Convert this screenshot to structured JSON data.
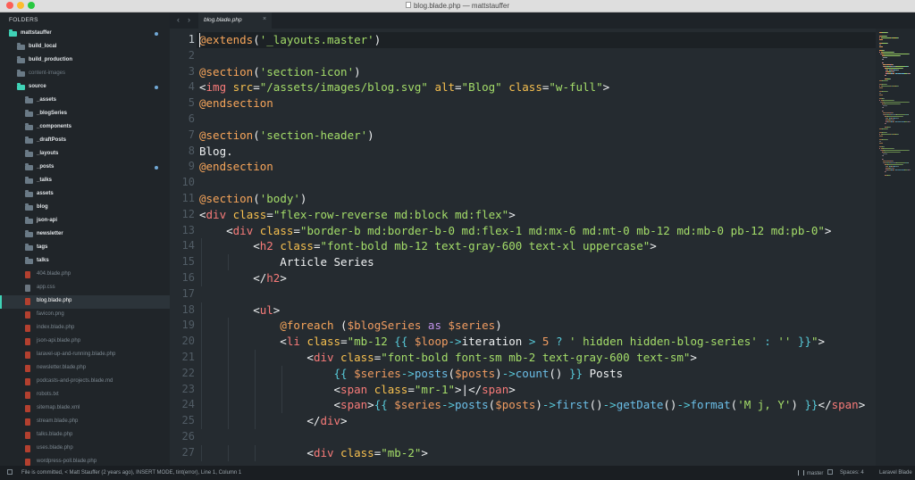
{
  "window": {
    "title": "blog.blade.php — mattstauffer"
  },
  "sidebar": {
    "header": "FOLDERS",
    "items": [
      {
        "label": "mattstauffer",
        "type": "folder-open",
        "depth": 0,
        "bold": true,
        "dot": true
      },
      {
        "label": "build_local",
        "type": "folder",
        "depth": 1,
        "bold": true
      },
      {
        "label": "build_production",
        "type": "folder",
        "depth": 1,
        "bold": true
      },
      {
        "label": "content-images",
        "type": "folder",
        "depth": 1,
        "dim": true
      },
      {
        "label": "source",
        "type": "folder-open",
        "depth": 1,
        "bold": true,
        "dot": true
      },
      {
        "label": "_assets",
        "type": "folder",
        "depth": 2,
        "bold": true
      },
      {
        "label": "_blogSeries",
        "type": "folder",
        "depth": 2,
        "bold": true
      },
      {
        "label": "_components",
        "type": "folder",
        "depth": 2,
        "bold": true
      },
      {
        "label": "_draftPosts",
        "type": "folder",
        "depth": 2,
        "bold": true
      },
      {
        "label": "_layouts",
        "type": "folder",
        "depth": 2,
        "bold": true
      },
      {
        "label": "_posts",
        "type": "folder",
        "depth": 2,
        "bold": true,
        "dot": true
      },
      {
        "label": "_talks",
        "type": "folder",
        "depth": 2,
        "bold": true
      },
      {
        "label": "assets",
        "type": "folder",
        "depth": 2,
        "bold": true
      },
      {
        "label": "blog",
        "type": "folder",
        "depth": 2,
        "bold": true
      },
      {
        "label": "json-api",
        "type": "folder",
        "depth": 2,
        "bold": true
      },
      {
        "label": "newsletter",
        "type": "folder",
        "depth": 2,
        "bold": true
      },
      {
        "label": "tags",
        "type": "folder",
        "depth": 2,
        "bold": true
      },
      {
        "label": "talks",
        "type": "folder",
        "depth": 2,
        "bold": true
      },
      {
        "label": "404.blade.php",
        "type": "file",
        "depth": 2
      },
      {
        "label": "app.css",
        "type": "file-gray",
        "depth": 2
      },
      {
        "label": "blog.blade.php",
        "type": "file",
        "depth": 2,
        "selected": true
      },
      {
        "label": "favicon.png",
        "type": "file",
        "depth": 2
      },
      {
        "label": "index.blade.php",
        "type": "file",
        "depth": 2
      },
      {
        "label": "json-api.blade.php",
        "type": "file",
        "depth": 2
      },
      {
        "label": "laravel-up-and-running.blade.php",
        "type": "file",
        "depth": 2
      },
      {
        "label": "newsletter.blade.php",
        "type": "file",
        "depth": 2
      },
      {
        "label": "podcasts-and-projects.blade.md",
        "type": "file",
        "depth": 2
      },
      {
        "label": "robots.txt",
        "type": "file",
        "depth": 2
      },
      {
        "label": "sitemap.blade.xml",
        "type": "file",
        "depth": 2
      },
      {
        "label": "stream.blade.php",
        "type": "file",
        "depth": 2
      },
      {
        "label": "talks.blade.php",
        "type": "file",
        "depth": 2
      },
      {
        "label": "uses.blade.php",
        "type": "file",
        "depth": 2
      },
      {
        "label": "wordpress-poll.blade.php",
        "type": "file",
        "depth": 2
      }
    ]
  },
  "tabs": {
    "back": "‹",
    "forward": "›",
    "items": [
      {
        "label": "blog.blade.php",
        "close": "×",
        "active": true
      }
    ]
  },
  "editor": {
    "active_line": 1,
    "lines": [
      [
        [
          "d",
          "@extends"
        ],
        [
          "tx",
          "("
        ],
        [
          "s",
          "'_layouts.master'"
        ],
        [
          "tx",
          ")"
        ]
      ],
      [],
      [
        [
          "d",
          "@section"
        ],
        [
          "tx",
          "("
        ],
        [
          "s",
          "'section-icon'"
        ],
        [
          "tx",
          ")"
        ]
      ],
      [
        [
          "tx",
          "<"
        ],
        [
          "t",
          "img"
        ],
        [
          "tx",
          " "
        ],
        [
          "a",
          "src"
        ],
        [
          "tx",
          "="
        ],
        [
          "s",
          "\"/assets/images/blog.svg\""
        ],
        [
          "tx",
          " "
        ],
        [
          "a",
          "alt"
        ],
        [
          "tx",
          "="
        ],
        [
          "s",
          "\"Blog\""
        ],
        [
          "tx",
          " "
        ],
        [
          "a",
          "class"
        ],
        [
          "tx",
          "="
        ],
        [
          "s",
          "\"w-full\""
        ],
        [
          "tx",
          ">"
        ]
      ],
      [
        [
          "d",
          "@endsection"
        ]
      ],
      [],
      [
        [
          "d",
          "@section"
        ],
        [
          "tx",
          "("
        ],
        [
          "s",
          "'section-header'"
        ],
        [
          "tx",
          ")"
        ]
      ],
      [
        [
          "tx",
          "Blog."
        ]
      ],
      [
        [
          "d",
          "@endsection"
        ]
      ],
      [],
      [
        [
          "d",
          "@section"
        ],
        [
          "tx",
          "("
        ],
        [
          "s",
          "'body'"
        ],
        [
          "tx",
          ")"
        ]
      ],
      [
        [
          "tx",
          "<"
        ],
        [
          "t",
          "div"
        ],
        [
          "tx",
          " "
        ],
        [
          "a",
          "class"
        ],
        [
          "tx",
          "="
        ],
        [
          "s",
          "\"flex-row-reverse md:block md:flex\""
        ],
        [
          "tx",
          ">"
        ]
      ],
      [
        [
          "tx",
          "    <"
        ],
        [
          "t",
          "div"
        ],
        [
          "tx",
          " "
        ],
        [
          "a",
          "class"
        ],
        [
          "tx",
          "="
        ],
        [
          "s",
          "\"border-b md:border-b-0 md:flex-1 md:mx-6 md:mt-0 mb-12 md:mb-0 pb-12 md:pb-0\""
        ],
        [
          "tx",
          ">"
        ]
      ],
      [
        [
          "tx",
          "        <"
        ],
        [
          "t",
          "h2"
        ],
        [
          "tx",
          " "
        ],
        [
          "a",
          "class"
        ],
        [
          "tx",
          "="
        ],
        [
          "s",
          "\"font-bold mb-12 text-gray-600 text-xl uppercase\""
        ],
        [
          "tx",
          ">"
        ]
      ],
      [
        [
          "tx",
          "            Article Series"
        ]
      ],
      [
        [
          "tx",
          "        </"
        ],
        [
          "t",
          "h2"
        ],
        [
          "tx",
          ">"
        ]
      ],
      [],
      [
        [
          "tx",
          "        <"
        ],
        [
          "t",
          "ul"
        ],
        [
          "tx",
          ">"
        ]
      ],
      [
        [
          "tx",
          "            "
        ],
        [
          "d",
          "@foreach"
        ],
        [
          "tx",
          " ("
        ],
        [
          "v",
          "$blogSeries"
        ],
        [
          "tx",
          " "
        ],
        [
          "k",
          "as"
        ],
        [
          "tx",
          " "
        ],
        [
          "v",
          "$series"
        ],
        [
          "tx",
          ")"
        ]
      ],
      [
        [
          "tx",
          "            <"
        ],
        [
          "t",
          "li"
        ],
        [
          "tx",
          " "
        ],
        [
          "a",
          "class"
        ],
        [
          "tx",
          "="
        ],
        [
          "s",
          "\"mb-12 "
        ],
        [
          "p",
          "{{ "
        ],
        [
          "v",
          "$loop"
        ],
        [
          "p",
          "->"
        ],
        [
          "tx",
          "iteration "
        ],
        [
          "p",
          ">"
        ],
        [
          "tx",
          " "
        ],
        [
          "n",
          "5"
        ],
        [
          "tx",
          " "
        ],
        [
          "p",
          "?"
        ],
        [
          "tx",
          " "
        ],
        [
          "s",
          "' hidden hidden-blog-series'"
        ],
        [
          "tx",
          " "
        ],
        [
          "p",
          ":"
        ],
        [
          "tx",
          " "
        ],
        [
          "s",
          "''"
        ],
        [
          "tx",
          " "
        ],
        [
          "p",
          "}}"
        ],
        [
          "s",
          "\""
        ],
        [
          "tx",
          ">"
        ]
      ],
      [
        [
          "tx",
          "                <"
        ],
        [
          "t",
          "div"
        ],
        [
          "tx",
          " "
        ],
        [
          "a",
          "class"
        ],
        [
          "tx",
          "="
        ],
        [
          "s",
          "\"font-bold font-sm mb-2 text-gray-600 text-sm\""
        ],
        [
          "tx",
          ">"
        ]
      ],
      [
        [
          "tx",
          "                    "
        ],
        [
          "p",
          "{{ "
        ],
        [
          "v",
          "$series"
        ],
        [
          "p",
          "->"
        ],
        [
          "f",
          "posts"
        ],
        [
          "tx",
          "("
        ],
        [
          "v",
          "$posts"
        ],
        [
          "tx",
          ")"
        ],
        [
          "p",
          "->"
        ],
        [
          "f",
          "count"
        ],
        [
          "tx",
          "() "
        ],
        [
          "p",
          "}}"
        ],
        [
          "tx",
          " Posts"
        ]
      ],
      [
        [
          "tx",
          "                    <"
        ],
        [
          "t",
          "span"
        ],
        [
          "tx",
          " "
        ],
        [
          "a",
          "class"
        ],
        [
          "tx",
          "="
        ],
        [
          "s",
          "\"mr-1\""
        ],
        [
          "tx",
          ">|</"
        ],
        [
          "t",
          "span"
        ],
        [
          "tx",
          ">"
        ]
      ],
      [
        [
          "tx",
          "                    <"
        ],
        [
          "t",
          "span"
        ],
        [
          "tx",
          ">"
        ],
        [
          "p",
          "{{ "
        ],
        [
          "v",
          "$series"
        ],
        [
          "p",
          "->"
        ],
        [
          "f",
          "posts"
        ],
        [
          "tx",
          "("
        ],
        [
          "v",
          "$posts"
        ],
        [
          "tx",
          ")"
        ],
        [
          "p",
          "->"
        ],
        [
          "f",
          "first"
        ],
        [
          "tx",
          "()"
        ],
        [
          "p",
          "->"
        ],
        [
          "f",
          "getDate"
        ],
        [
          "tx",
          "()"
        ],
        [
          "p",
          "->"
        ],
        [
          "f",
          "format"
        ],
        [
          "tx",
          "("
        ],
        [
          "s",
          "'M j, Y'"
        ],
        [
          "tx",
          ") "
        ],
        [
          "p",
          "}}"
        ],
        [
          "tx",
          "</"
        ],
        [
          "t",
          "span"
        ],
        [
          "tx",
          ">"
        ]
      ],
      [
        [
          "tx",
          "                </"
        ],
        [
          "t",
          "div"
        ],
        [
          "tx",
          ">"
        ]
      ],
      [],
      [
        [
          "tx",
          "                <"
        ],
        [
          "t",
          "div"
        ],
        [
          "tx",
          " "
        ],
        [
          "a",
          "class"
        ],
        [
          "tx",
          "="
        ],
        [
          "s",
          "\"mb-2\""
        ],
        [
          "tx",
          ">"
        ]
      ]
    ]
  },
  "status": {
    "message": "File is committed, < Matt Stauffer (2 years ago), INSERT MODE, tint(error), Line 1, Column 1",
    "branch": "master",
    "spaces": "Spaces: 4",
    "syntax": "Laravel Blade"
  },
  "colors": {
    "background": "#252b30",
    "sidebar": "#202529",
    "accent": "#3fd2b6"
  }
}
